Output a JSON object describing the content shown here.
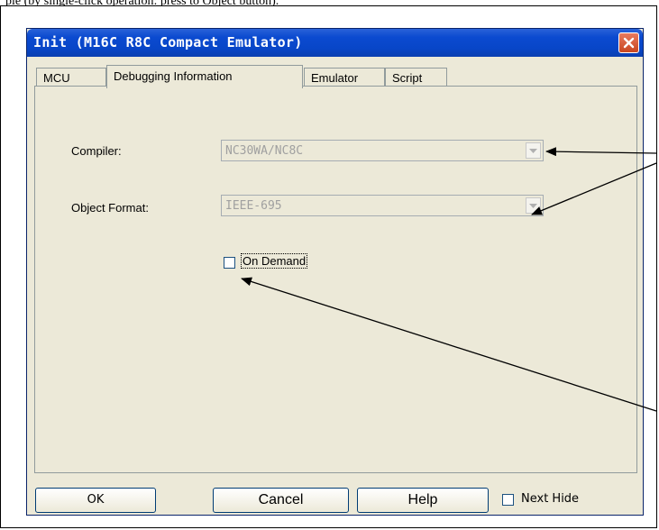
{
  "top_text": "ple (by single-click operation: press to Object button).",
  "dialog": {
    "title": "Init (M16C R8C Compact Emulator)",
    "close_label": "×"
  },
  "tabs": [
    {
      "label": "MCU",
      "active": false
    },
    {
      "label": "Debugging Information",
      "active": true
    },
    {
      "label": "Emulator",
      "active": false
    },
    {
      "label": "Script",
      "active": false
    }
  ],
  "fields": {
    "compiler_label": "Compiler:",
    "compiler_value": "NC30WA/NC8C",
    "object_format_label": "Object Format:",
    "object_format_value": "IEEE-695",
    "on_demand_label": "On Demand",
    "on_demand_checked": false
  },
  "buttons": {
    "ok": "OK",
    "cancel": "Cancel",
    "help": "Help",
    "next_hide": "Next Hide",
    "next_hide_checked": false
  },
  "colors": {
    "titlebar": "#0846c8",
    "dialog_bg": "#ece9d8",
    "close_button": "#c84620"
  }
}
